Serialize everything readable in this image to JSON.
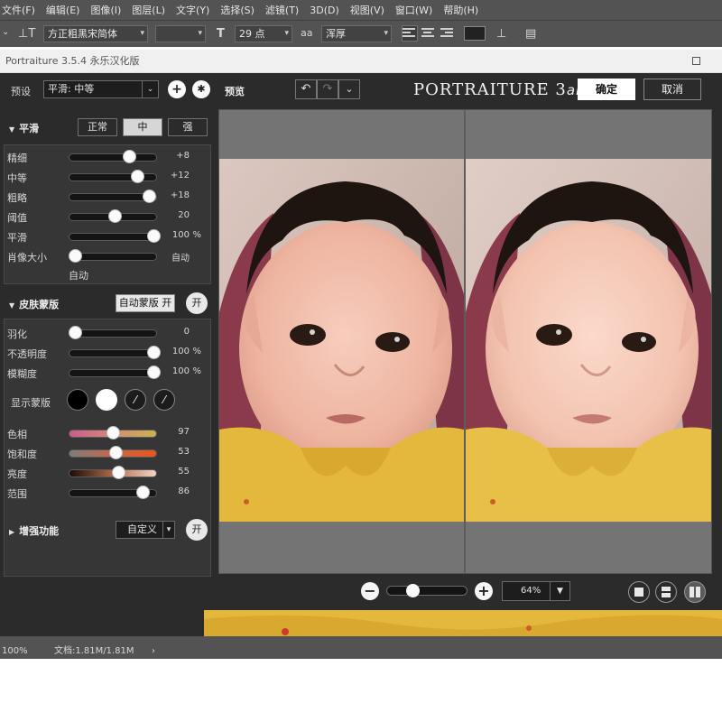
{
  "ps_menu": [
    "文件(F)",
    "编辑(E)",
    "图像(I)",
    "图层(L)",
    "文字(Y)",
    "选择(S)",
    "滤镜(T)",
    "3D(D)",
    "视图(V)",
    "窗口(W)",
    "帮助(H)"
  ],
  "ps_options": {
    "font_family": "方正粗黑宋简体",
    "font_style": "",
    "font_size": "29 点",
    "antialias_icon": "aa",
    "antialias": "浑厚"
  },
  "plugin_title": "Portraiture 3.5.4 永乐汉化版",
  "preset": {
    "label": "预设",
    "value": "平滑: 中等"
  },
  "smoothing": {
    "title": "平滑",
    "modes": [
      "正常",
      "中",
      "强"
    ],
    "active_mode": 1,
    "sliders": [
      {
        "label": "精细",
        "value": "+8",
        "pos": 0.69,
        "unit": ""
      },
      {
        "label": "中等",
        "value": "+12",
        "pos": 0.78,
        "unit": ""
      },
      {
        "label": "粗略",
        "value": "+18",
        "pos": 0.92,
        "unit": ""
      },
      {
        "label": "阈值",
        "value": "20",
        "pos": 0.52,
        "unit": ""
      },
      {
        "label": "平滑",
        "value": "100",
        "pos": 0.97,
        "unit": "%"
      },
      {
        "label": "肖像大小",
        "value": "自动",
        "pos": 0.06,
        "unit": ""
      }
    ],
    "portrait_size_note": "自动"
  },
  "skin_mask": {
    "title": "皮肤蒙版",
    "auto_button": "自动蒙版 开",
    "toggle": "开",
    "sliders": [
      {
        "label": "羽化",
        "value": "0",
        "pos": 0.06,
        "unit": ""
      },
      {
        "label": "不透明度",
        "value": "100",
        "pos": 0.97,
        "unit": "%"
      },
      {
        "label": "模糊度",
        "value": "100",
        "pos": 0.97,
        "unit": "%"
      }
    ],
    "show_mask_label": "显示蒙版",
    "color_sliders": [
      {
        "label": "色相",
        "value": "97",
        "pos": 0.5,
        "gradient": "linear-gradient(90deg,#c95d8a,#d48a78,#c9b250)"
      },
      {
        "label": "饱和度",
        "value": "53",
        "pos": 0.53,
        "gradient": "linear-gradient(90deg,#7d7d7d,#c8674a,#e8561c)"
      },
      {
        "label": "亮度",
        "value": "55",
        "pos": 0.56,
        "gradient": "linear-gradient(90deg,#1a0c06,#b06a4a,#f2d4c6)"
      },
      {
        "label": "范围",
        "value": "86",
        "pos": 0.84,
        "gradient": "none"
      }
    ]
  },
  "enhance": {
    "title": "增强功能",
    "preset_value": "自定义",
    "toggle": "开"
  },
  "preview_label": "预览",
  "brand": {
    "main": "PORTRAITURE",
    "ver": "3",
    "suffix": "ai"
  },
  "ok_label": "确定",
  "cancel_label": "取消",
  "zoom": {
    "value": "64%",
    "pos": 0.32
  },
  "status": {
    "zoom": "100%",
    "doc": "文档:1.81M/1.81M"
  }
}
